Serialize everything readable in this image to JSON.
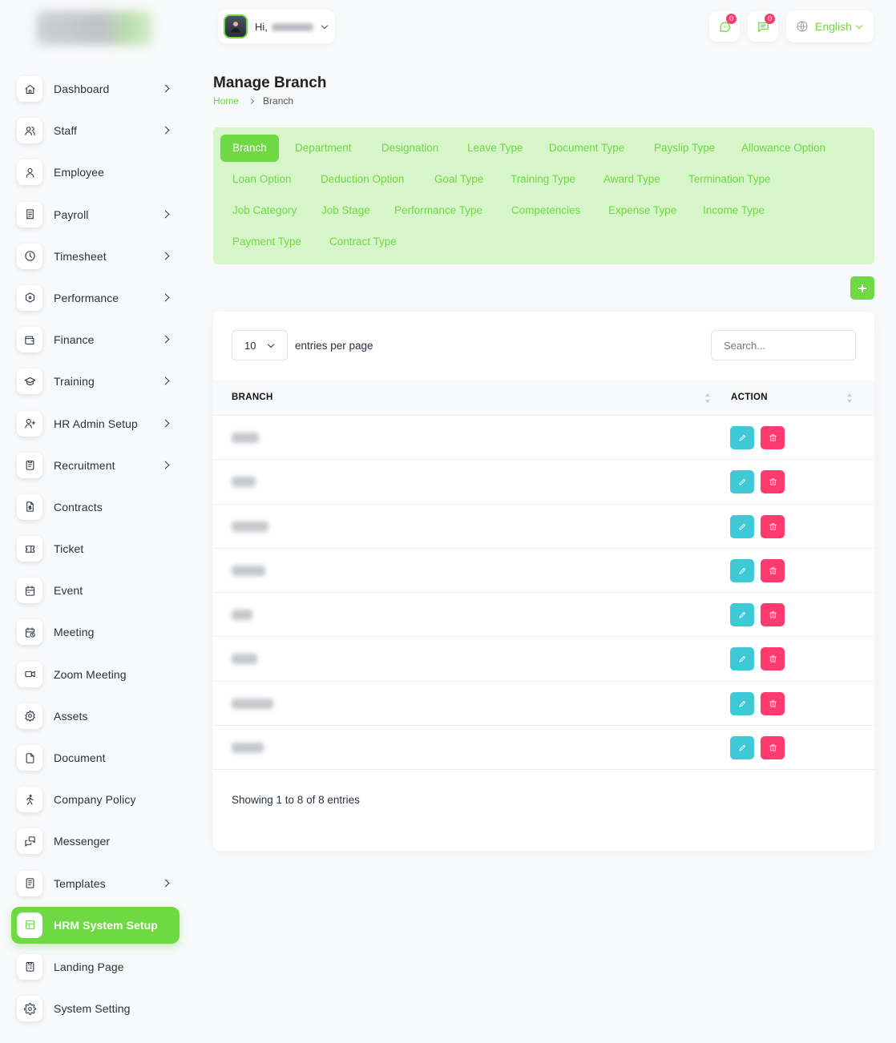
{
  "sidebar": {
    "items": [
      {
        "label": "Dashboard",
        "icon": "home-icon",
        "chevron": true
      },
      {
        "label": "Staff",
        "icon": "users-icon",
        "chevron": true
      },
      {
        "label": "Employee",
        "icon": "user-icon",
        "chevron": false
      },
      {
        "label": "Payroll",
        "icon": "receipt-icon",
        "chevron": true
      },
      {
        "label": "Timesheet",
        "icon": "clock-icon",
        "chevron": true
      },
      {
        "label": "Performance",
        "icon": "hexagon-icon",
        "chevron": true
      },
      {
        "label": "Finance",
        "icon": "wallet-icon",
        "chevron": true
      },
      {
        "label": "Training",
        "icon": "graduation-cap-icon",
        "chevron": true
      },
      {
        "label": "HR Admin Setup",
        "icon": "user-plus-icon",
        "chevron": true
      },
      {
        "label": "Recruitment",
        "icon": "clipboard-icon",
        "chevron": true
      },
      {
        "label": "Contracts",
        "icon": "file-dollar-icon",
        "chevron": false
      },
      {
        "label": "Ticket",
        "icon": "ticket-icon",
        "chevron": false
      },
      {
        "label": "Event",
        "icon": "calendar-icon",
        "chevron": false
      },
      {
        "label": "Meeting",
        "icon": "calendar-time-icon",
        "chevron": false
      },
      {
        "label": "Zoom Meeting",
        "icon": "video-icon",
        "chevron": false
      },
      {
        "label": "Assets",
        "icon": "settings-cog-icon",
        "chevron": false
      },
      {
        "label": "Document",
        "icon": "file-icon",
        "chevron": false
      },
      {
        "label": "Company Policy",
        "icon": "walk-icon",
        "chevron": false
      },
      {
        "label": "Messenger",
        "icon": "messages-icon",
        "chevron": false
      },
      {
        "label": "Templates",
        "icon": "template-icon",
        "chevron": true
      },
      {
        "label": "HRM System Setup",
        "icon": "layout-icon",
        "chevron": false,
        "active": true
      },
      {
        "label": "Landing Page",
        "icon": "clipboard-list-icon",
        "chevron": false
      },
      {
        "label": "System Setting",
        "icon": "gear-icon",
        "chevron": false
      }
    ]
  },
  "header": {
    "greeting": "Hi,",
    "notifications": {
      "chat_count": "0",
      "message_count": "0"
    },
    "language": "English"
  },
  "page": {
    "title": "Manage Branch",
    "breadcrumb": {
      "home": "Home",
      "current": "Branch"
    }
  },
  "tabs": [
    "Branch",
    "Department",
    "Designation",
    "Leave Type",
    "Document Type",
    "Payslip Type",
    "Allowance Option",
    "Loan Option",
    "Deduction Option",
    "Goal Type",
    "Training Type",
    "Award Type",
    "Termination Type",
    "Job Category",
    "Job Stage",
    "Performance Type",
    "Competencies",
    "Expense Type",
    "Income Type",
    "Payment Type",
    "Contract Type"
  ],
  "active_tab": "Branch",
  "table": {
    "per_page": "10",
    "per_page_label": "entries per page",
    "search_placeholder": "Search...",
    "columns": [
      "BRANCH",
      "ACTION"
    ],
    "row_count": 8,
    "footer": "Showing 1 to 8 of 8 entries"
  },
  "colors": {
    "primary": "#6fd943",
    "tab_panel_bg": "#d6f5c9",
    "edit": "#3ec9d6",
    "delete": "#ff3a6e",
    "badge": "#ff3a6e"
  }
}
